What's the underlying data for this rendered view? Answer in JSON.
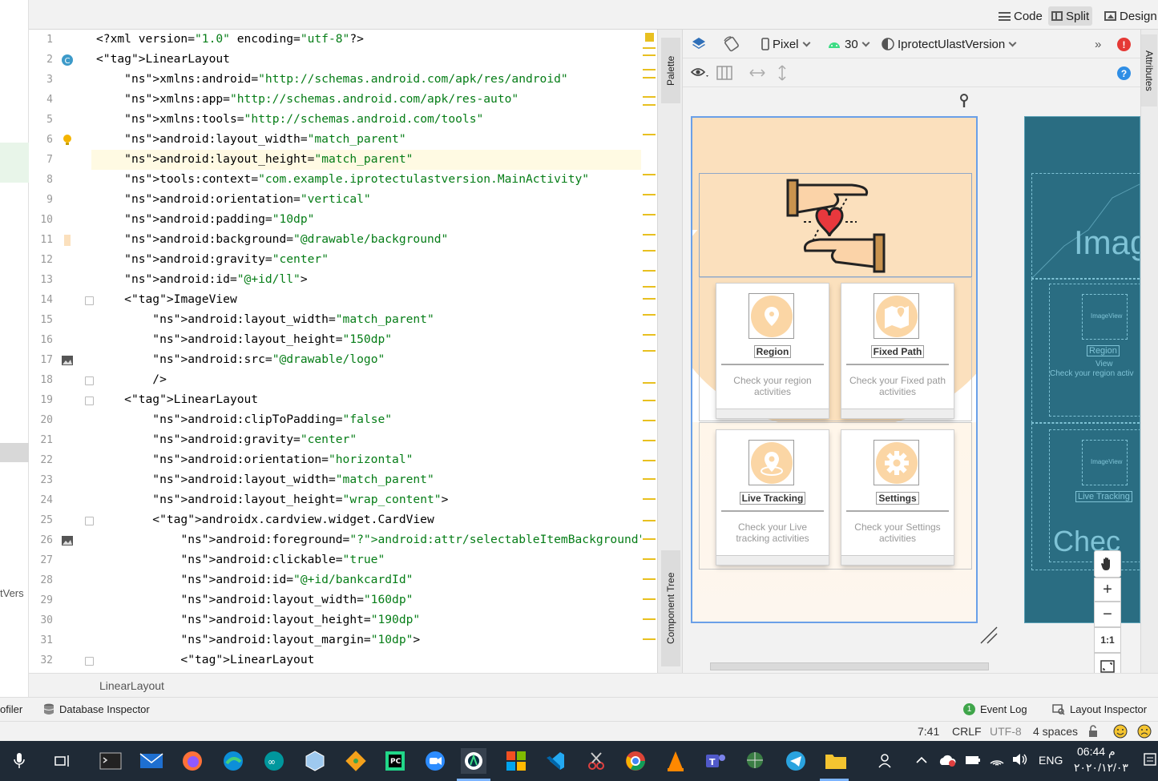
{
  "view_modes": {
    "code": "Code",
    "split": "Split",
    "design": "Design"
  },
  "left_panel_text": "tVers",
  "editor": {
    "lines": [
      {
        "n": "1",
        "text": "<?xml version=\"1.0\" encoding=\"utf-8\"?>"
      },
      {
        "n": "2",
        "text": "<LinearLayout"
      },
      {
        "n": "3",
        "text": "    xmlns:android=\"http://schemas.android.com/apk/res/android\""
      },
      {
        "n": "4",
        "text": "    xmlns:app=\"http://schemas.android.com/apk/res-auto\""
      },
      {
        "n": "5",
        "text": "    xmlns:tools=\"http://schemas.android.com/tools\""
      },
      {
        "n": "6",
        "text": "    android:layout_width=\"match_parent\""
      },
      {
        "n": "7",
        "text": "    android:layout_height=\"match_parent\""
      },
      {
        "n": "8",
        "text": "    tools:context=\"com.example.iprotectulastversion.MainActivity\""
      },
      {
        "n": "9",
        "text": "    android:orientation=\"vertical\""
      },
      {
        "n": "10",
        "text": "    android:padding=\"10dp\""
      },
      {
        "n": "11",
        "text": "    android:background=\"@drawable/background\""
      },
      {
        "n": "12",
        "text": "    android:gravity=\"center\""
      },
      {
        "n": "13",
        "text": "    android:id=\"@+id/ll\">"
      },
      {
        "n": "14",
        "text": "    <ImageView"
      },
      {
        "n": "15",
        "text": "        android:layout_width=\"match_parent\""
      },
      {
        "n": "16",
        "text": "        android:layout_height=\"150dp\""
      },
      {
        "n": "17",
        "text": "        android:src=\"@drawable/logo\""
      },
      {
        "n": "18",
        "text": "        />"
      },
      {
        "n": "19",
        "text": "    <LinearLayout"
      },
      {
        "n": "20",
        "text": "        android:clipToPadding=\"false\""
      },
      {
        "n": "21",
        "text": "        android:gravity=\"center\""
      },
      {
        "n": "22",
        "text": "        android:orientation=\"horizontal\""
      },
      {
        "n": "23",
        "text": "        android:layout_width=\"match_parent\""
      },
      {
        "n": "24",
        "text": "        android:layout_height=\"wrap_content\">"
      },
      {
        "n": "25",
        "text": "        <androidx.cardview.widget.CardView"
      },
      {
        "n": "26",
        "text": "            android:foreground=\"?android:attr/selectableItemBackground\""
      },
      {
        "n": "27",
        "text": "            android:clickable=\"true\""
      },
      {
        "n": "28",
        "text": "            android:id=\"@+id/bankcardId\""
      },
      {
        "n": "29",
        "text": "            android:layout_width=\"160dp\""
      },
      {
        "n": "30",
        "text": "            android:layout_height=\"190dp\""
      },
      {
        "n": "31",
        "text": "            android:layout_margin=\"10dp\">"
      },
      {
        "n": "32",
        "text": "            <LinearLayout"
      }
    ]
  },
  "side_tabs": {
    "palette": "Palette",
    "component_tree": "Component Tree",
    "attributes": "Attributes"
  },
  "design_toolbar": {
    "device": "Pixel",
    "api": "30",
    "theme": "IprotectUlastVersion",
    "more": "»",
    "error": "!",
    "help": "?"
  },
  "preview_cards": [
    {
      "label": "Region",
      "desc": "Check your region activities"
    },
    {
      "label": "Fixed Path",
      "desc": "Check your Fixed path activities"
    },
    {
      "label": "Live Tracking",
      "desc": "Check your Live tracking activities"
    },
    {
      "label": "Settings",
      "desc": "Check your Settings activities"
    }
  ],
  "blueprint": {
    "image_text": "Imag",
    "imageview": "ImageView",
    "region": "Region",
    "view": "View",
    "check_region": "Check your region activ",
    "live_tracking": "Live Tracking",
    "check": "Chec"
  },
  "zoom": {
    "plus": "+",
    "minus": "−",
    "one_to_one": "1:1"
  },
  "breadcrumb": "LinearLayout",
  "tool_windows": {
    "profiler": "ofiler",
    "database_inspector": "Database Inspector",
    "event_log": "Event Log",
    "event_log_count": "1",
    "layout_inspector": "Layout Inspector"
  },
  "status": {
    "position": "7:41",
    "line_sep": "CRLF",
    "encoding": "UTF-8",
    "indent": "4 spaces"
  },
  "tray": {
    "lang": "ENG",
    "time": "06:44 م",
    "date": "٢٠٢٠/١٢/٠٣"
  }
}
